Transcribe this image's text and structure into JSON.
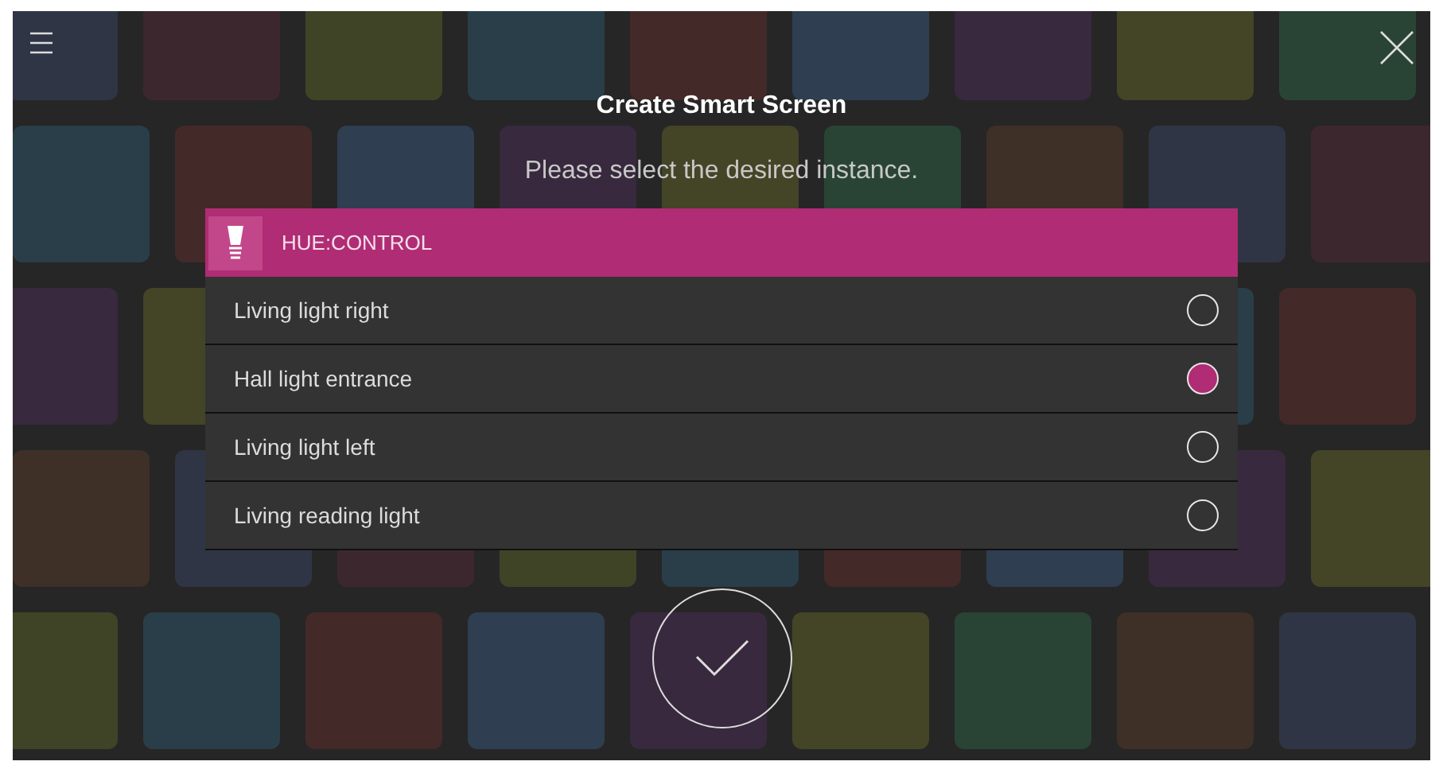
{
  "title": "Create Smart Screen",
  "subtitle": "Please select the desired instance.",
  "group": {
    "label": "HUE:CONTROL"
  },
  "instances": [
    {
      "name": "Living light right",
      "selected": false
    },
    {
      "name": "Hall light entrance",
      "selected": true
    },
    {
      "name": "Living light left",
      "selected": false
    },
    {
      "name": "Living reading light",
      "selected": false
    }
  ]
}
